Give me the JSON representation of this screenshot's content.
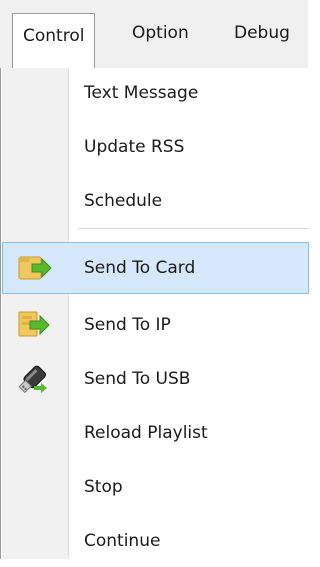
{
  "menubar": {
    "items": [
      {
        "label": "Control"
      },
      {
        "label": "Option"
      },
      {
        "label": "Debug"
      }
    ]
  },
  "dropdown": {
    "items": [
      {
        "label": "Text Message"
      },
      {
        "label": "Update RSS"
      },
      {
        "label": "Schedule"
      },
      {
        "label": "Send To Card",
        "icon": "send-to-card-icon"
      },
      {
        "label": "Send To IP",
        "icon": "send-to-ip-icon"
      },
      {
        "label": "Send To USB",
        "icon": "usb-drive-icon"
      },
      {
        "label": "Reload Playlist"
      },
      {
        "label": "Stop"
      },
      {
        "label": "Continue"
      }
    ]
  },
  "colors": {
    "highlight_fill": "#d6e8fb",
    "highlight_border": "#8fbce8",
    "arrow_green": "#5ab82e",
    "folder_yellow": "#f0c860"
  }
}
